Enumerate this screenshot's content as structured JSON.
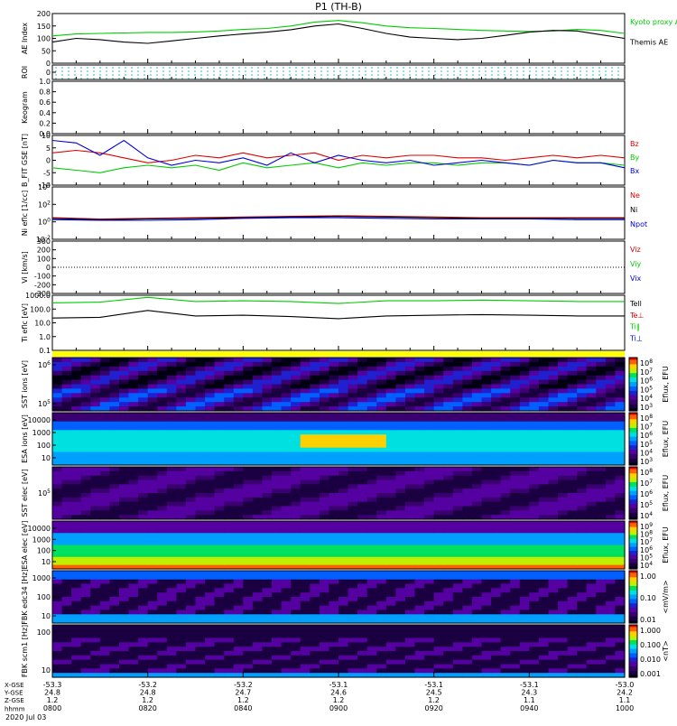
{
  "chart_data": {
    "type": "line",
    "title": "P1  (TH-B)",
    "date_label": "2020 Jul 03",
    "x_ticks": [
      "0800",
      "0820",
      "0840",
      "0900",
      "0920",
      "0940",
      "1000"
    ],
    "footer_labels": [
      "X-GSE",
      "Y-GSE",
      "Z-GSE",
      "hhmm"
    ],
    "footer_rows": [
      [
        "-53.3",
        "-53.2",
        "-53.2",
        "-53.1",
        "-53.1",
        "-53.1",
        "-53.0"
      ],
      [
        "24.8",
        "24.8",
        "24.7",
        "24.6",
        "24.5",
        "24.3",
        "24.2"
      ],
      [
        "1.2",
        "1.2",
        "1.2",
        "1.2",
        "1.2",
        "1.1",
        "1.1"
      ]
    ],
    "panels": [
      {
        "ylabel": "AE Index",
        "yticks": [
          "200",
          "150",
          "100",
          "50",
          "0"
        ],
        "ylim": [
          0,
          200
        ],
        "series": [
          {
            "name": "Kyoto proxy AE",
            "color": "#00cc00",
            "x": [
              0,
              5,
              10,
              15,
              20,
              25,
              30,
              35,
              40,
              45,
              50,
              55,
              60,
              65,
              70,
              75,
              80,
              85,
              90,
              95,
              100,
              105,
              110,
              115,
              120
            ],
            "values": [
              110,
              118,
              120,
              122,
              124,
              124,
              126,
              130,
              136,
              140,
              150,
              166,
              172,
              163,
              150,
              143,
              140,
              136,
              132,
              130,
              128,
              130,
              136,
              132,
              120
            ]
          },
          {
            "name": "Themis AE",
            "color": "#000000",
            "x": [
              0,
              5,
              10,
              15,
              20,
              25,
              30,
              35,
              40,
              45,
              50,
              55,
              60,
              65,
              70,
              75,
              80,
              85,
              90,
              95,
              100,
              105,
              110,
              115,
              120
            ],
            "values": [
              85,
              100,
              95,
              85,
              80,
              90,
              100,
              110,
              118,
              125,
              135,
              150,
              158,
              140,
              120,
              105,
              100,
              95,
              100,
              112,
              125,
              132,
              130,
              115,
              100
            ]
          }
        ]
      },
      {
        "ylabel": "ROI",
        "yticks": [
          "0"
        ],
        "ylim": [
          0,
          1
        ],
        "series": []
      },
      {
        "ylabel": "Keogram",
        "yticks": [
          "1.0",
          "0.8",
          "0.6",
          "0.4",
          "0.2",
          "0.0"
        ],
        "ylim": [
          0,
          1
        ],
        "series": []
      },
      {
        "ylabel": "B_FIT GSE [nT]",
        "yticks": [
          "10",
          "5",
          "0",
          "-5",
          "-10"
        ],
        "ylim": [
          -10,
          10
        ],
        "series": [
          {
            "name": "Bz",
            "color": "#dd0000",
            "x": [
              0,
              5,
              10,
              15,
              20,
              25,
              30,
              35,
              40,
              45,
              50,
              55,
              60,
              65,
              70,
              75,
              80,
              85,
              90,
              95,
              100,
              105,
              110,
              115,
              120
            ],
            "values": [
              3,
              4,
              3,
              1,
              -1,
              0,
              2,
              1,
              3,
              1,
              2,
              3,
              0,
              2,
              1,
              2,
              2,
              1,
              1,
              0,
              1,
              2,
              1,
              2,
              1
            ]
          },
          {
            "name": "By",
            "color": "#00cc00",
            "x": [
              0,
              5,
              10,
              15,
              20,
              25,
              30,
              35,
              40,
              45,
              50,
              55,
              60,
              65,
              70,
              75,
              80,
              85,
              90,
              95,
              100,
              105,
              110,
              115,
              120
            ],
            "values": [
              -3,
              -4,
              -5,
              -3,
              -2,
              -3,
              -2,
              -4,
              -1,
              -3,
              -2,
              -1,
              -3,
              -1,
              -2,
              -1,
              -1,
              -2,
              -1,
              -1,
              -2,
              0,
              -1,
              -1,
              -2
            ]
          },
          {
            "name": "Bx",
            "color": "#0000dd",
            "x": [
              0,
              5,
              10,
              15,
              20,
              25,
              30,
              35,
              40,
              45,
              50,
              55,
              60,
              65,
              70,
              75,
              80,
              85,
              90,
              95,
              100,
              105,
              110,
              115,
              120
            ],
            "values": [
              8,
              7,
              2,
              8,
              1,
              -2,
              0,
              -1,
              1,
              -2,
              3,
              -1,
              2,
              0,
              -1,
              0,
              -2,
              -1,
              0,
              -1,
              -2,
              0,
              -1,
              -1,
              -3
            ]
          }
        ]
      },
      {
        "ylabel": "Ni eflc [1/cc]",
        "yticks": [
          "10^4",
          "10^2",
          "10^0",
          "10^-2"
        ],
        "ylim": [
          -3,
          5
        ],
        "series": [
          {
            "name": "Ne",
            "color": "#dd0000",
            "x": [
              0,
              10,
              20,
              30,
              40,
              50,
              60,
              70,
              80,
              90,
              100,
              110,
              120
            ],
            "values": [
              0.3,
              0.1,
              0.2,
              0.3,
              0.4,
              0.5,
              0.6,
              0.5,
              0.4,
              0.3,
              0.3,
              0.3,
              0.3
            ]
          },
          {
            "name": "Ni",
            "color": "#000000",
            "x": [
              0,
              10,
              20,
              30,
              40,
              50,
              60,
              70,
              80,
              90,
              100,
              110,
              120
            ],
            "values": [
              0.2,
              0.0,
              0.1,
              0.2,
              0.3,
              0.4,
              0.5,
              0.4,
              0.3,
              0.2,
              0.2,
              0.2,
              0.2
            ]
          },
          {
            "name": "Npot",
            "color": "#0000dd",
            "x": [
              0,
              10,
              20,
              30,
              40,
              50,
              60,
              70,
              80,
              90,
              100,
              110,
              120
            ],
            "values": [
              0.0,
              -0.1,
              -0.1,
              0.0,
              0.2,
              0.3,
              0.3,
              0.2,
              0.1,
              0.1,
              0.1,
              0.0,
              0.0
            ]
          }
        ]
      },
      {
        "ylabel": "Vi [km/s]",
        "yticks": [
          "300",
          "200",
          "100",
          "0",
          "-100",
          "-200",
          "-300"
        ],
        "ylim": [
          -300,
          300
        ],
        "series": [
          {
            "name": "Viz",
            "color": "#dd0000",
            "x": [],
            "values": []
          },
          {
            "name": "Viy",
            "color": "#00cc00",
            "x": [],
            "values": []
          },
          {
            "name": "Vix",
            "color": "#0000dd",
            "x": [],
            "values": []
          }
        ]
      },
      {
        "ylabel": "Ti eflc [eV]",
        "yticks": [
          "1000.0",
          "100.0",
          "10.0",
          "1.0",
          "0.1"
        ],
        "ylim": [
          -1,
          3
        ],
        "series": [
          {
            "name": "Tell",
            "color": "#000000",
            "x": [
              0,
              10,
              20,
              30,
              40,
              50,
              60,
              70,
              80,
              90,
              100,
              110,
              120
            ],
            "values": [
              1.35,
              1.4,
              1.9,
              1.5,
              1.55,
              1.45,
              1.3,
              1.5,
              1.55,
              1.6,
              1.55,
              1.5,
              1.5
            ]
          },
          {
            "name": "Te⊥",
            "color": "#dd0000",
            "x": [],
            "values": []
          },
          {
            "name": "Ti‖",
            "color": "#00cc00",
            "x": [
              0,
              10,
              20,
              30,
              40,
              50,
              60,
              70,
              80,
              90,
              100,
              110,
              120
            ],
            "values": [
              2.45,
              2.5,
              2.85,
              2.55,
              2.6,
              2.55,
              2.4,
              2.6,
              2.6,
              2.65,
              2.6,
              2.55,
              2.55
            ]
          },
          {
            "name": "Ti⊥",
            "color": "#0000dd",
            "x": [],
            "values": []
          }
        ]
      }
    ],
    "spectrograms": [
      {
        "ylabel": "SST ions [eV]",
        "yticks": [
          "10^6",
          "10^5"
        ],
        "colorbar_title": "Eflux, EFU",
        "colorbar_ticks": [
          "10^8",
          "10^7",
          "10^6",
          "10^5",
          "10^4",
          "10^3"
        ]
      },
      {
        "ylabel": "ESA ions [eV]",
        "yticks": [
          "10000",
          "1000",
          "100",
          "10"
        ],
        "colorbar_title": "Eflux, EFU",
        "colorbar_ticks": [
          "10^8",
          "10^7",
          "10^6",
          "10^5",
          "10^4",
          "10^3"
        ]
      },
      {
        "ylabel": "SST elec [eV]",
        "yticks": [
          "10^5"
        ],
        "colorbar_title": "Eflux, EFU",
        "colorbar_ticks": [
          "10^8",
          "10^7",
          "10^6",
          "10^5",
          "10^4"
        ]
      },
      {
        "ylabel": "ESA elec [eV]",
        "yticks": [
          "10000",
          "1000",
          "100",
          "10"
        ],
        "colorbar_title": "Eflux, EFU",
        "colorbar_ticks": [
          "10^9",
          "10^8",
          "10^7",
          "10^6",
          "10^5",
          "10^4"
        ]
      },
      {
        "ylabel": "FBK edc34 [Hz]",
        "yticks": [
          "1000",
          "100",
          "10"
        ],
        "colorbar_title": "<mV/m>",
        "colorbar_ticks": [
          "1.00",
          "0.10",
          "0.01"
        ]
      },
      {
        "ylabel": "FBK scm1 [Hz]",
        "yticks": [
          "100",
          "10"
        ],
        "colorbar_title": "<nT>",
        "colorbar_ticks": [
          "1.000",
          "0.100",
          "0.010",
          "0.001"
        ]
      }
    ]
  }
}
